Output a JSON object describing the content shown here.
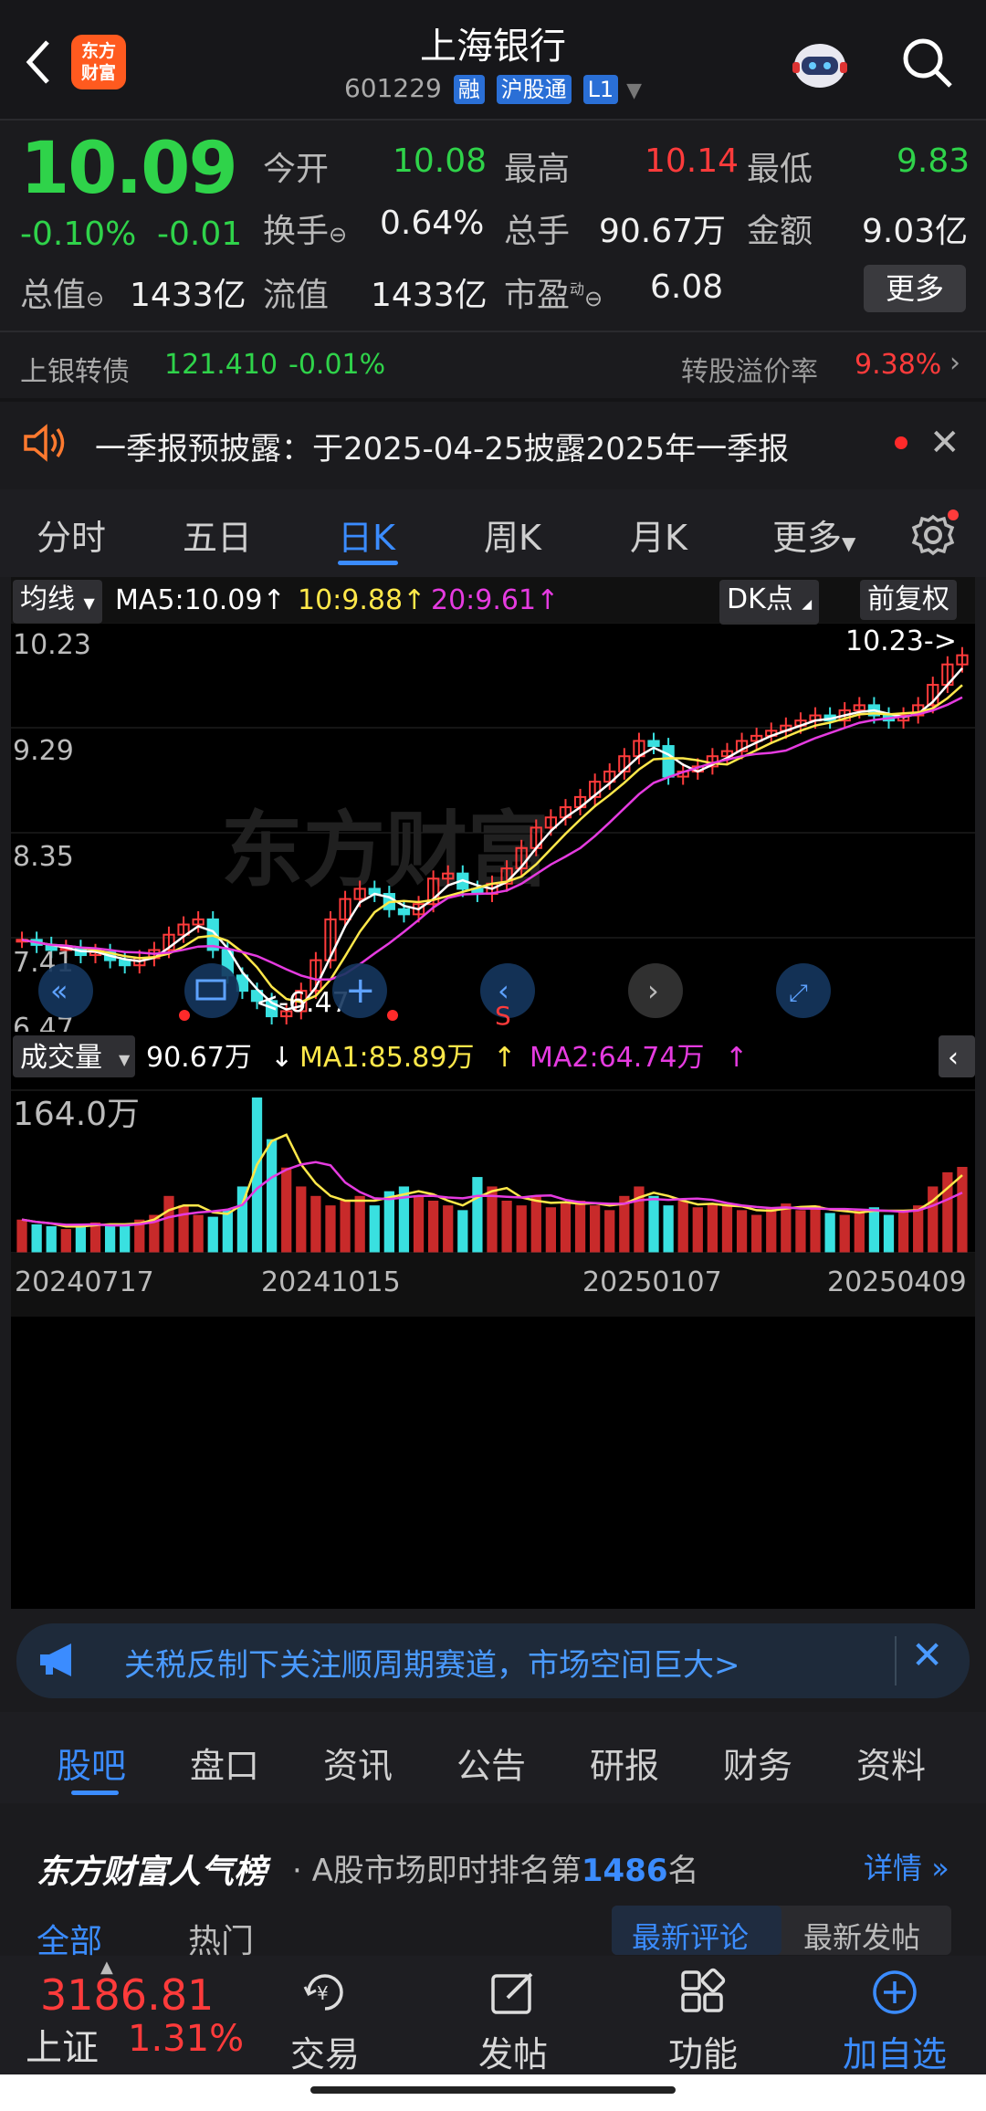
{
  "header": {
    "title": "上海银行",
    "code": "601229",
    "tags": [
      "融",
      "沪股通",
      "L1"
    ],
    "logo_text": "东方财富"
  },
  "quote": {
    "price": "10.09",
    "change_pct": "-0.10%",
    "change": "-0.01",
    "open_label": "今开",
    "open": "10.08",
    "high_label": "最高",
    "high": "10.14",
    "low_label": "最低",
    "low": "9.83",
    "turnover_label": "换手",
    "turnover": "0.64%",
    "volume_label": "总手",
    "volume": "90.67万",
    "amount_label": "金额",
    "amount": "9.03亿",
    "mktcap_label": "总值",
    "mktcap": "1433亿",
    "float_label": "流值",
    "float_cap": "1433亿",
    "pe_label": "市盈",
    "pe_sup": "动",
    "pe": "6.08",
    "more_label": "更多"
  },
  "bond": {
    "name": "上银转债",
    "price": "121.410",
    "change": "-0.01%",
    "premium_label": "转股溢价率",
    "premium": "9.38%"
  },
  "notice": {
    "text": "一季报预披露：于2025-04-25披露2025年一季报"
  },
  "chart_tabs": [
    "分时",
    "五日",
    "日K",
    "周K",
    "月K",
    "更多"
  ],
  "active_chart_tab": "日K",
  "ma_legend": {
    "selector": "均线",
    "ma5": "MA5:10.09",
    "ma10": "10:9.88",
    "ma20": "20:9.61",
    "dk": "DK点",
    "adjust": "前复权"
  },
  "price_axis": [
    "10.23",
    "9.29",
    "8.35",
    "7.41",
    "6.47"
  ],
  "price_markers": {
    "high": "10.23->",
    "low": "<-6.47"
  },
  "volume_legend": {
    "selector": "成交量",
    "value": "90.67万",
    "ma1": "MA1:85.89万",
    "ma2": "MA2:64.74万"
  },
  "volume_axis_max": "164.0万",
  "date_labels": [
    "20240717",
    "20241015",
    "20250107",
    "20250409"
  ],
  "watermark": "东方财富",
  "banner": {
    "text": "关税反制下关注顺周期赛道，市场空间巨大>"
  },
  "sub_tabs": [
    "股吧",
    "盘口",
    "资讯",
    "公告",
    "研报",
    "财务",
    "资料"
  ],
  "active_sub_tab": "股吧",
  "popularity": {
    "brand": "东方财富人气榜",
    "prefix": "· A股市场即时排名第",
    "rank": "1486",
    "suffix": "名",
    "details": "详情"
  },
  "comment_tabs": {
    "all": "全部",
    "hot": "热门",
    "latest_comment": "最新评论",
    "latest_post": "最新发帖"
  },
  "bottom": {
    "index_value": "3186.81",
    "index_name": "上证",
    "index_change": "1.31%",
    "trade": "交易",
    "post": "发帖",
    "function": "功能",
    "add_watch": "加自选"
  },
  "colors": {
    "up": "#ff3b3b",
    "down": "#2fd34a",
    "accent": "#3b8cff",
    "ma5": "#ffffff",
    "ma10": "#ffe84a",
    "ma20": "#e53be0"
  },
  "chart_data": {
    "type": "candlestick",
    "y_range": [
      6.47,
      10.23
    ],
    "price_points": [
      7.3,
      7.25,
      7.2,
      7.22,
      7.15,
      7.18,
      7.1,
      7.05,
      7.12,
      7.2,
      7.35,
      7.45,
      7.5,
      7.2,
      6.95,
      6.8,
      6.7,
      6.55,
      6.6,
      6.8,
      7.1,
      7.5,
      7.7,
      7.8,
      7.75,
      7.6,
      7.55,
      7.65,
      7.9,
      7.95,
      7.8,
      7.75,
      7.85,
      8.0,
      8.2,
      8.4,
      8.5,
      8.6,
      8.7,
      8.85,
      8.95,
      9.1,
      9.25,
      9.2,
      8.9,
      8.95,
      9.0,
      9.1,
      9.15,
      9.25,
      9.3,
      9.35,
      9.4,
      9.45,
      9.5,
      9.45,
      9.55,
      9.6,
      9.5,
      9.45,
      9.5,
      9.6,
      9.8,
      10.0,
      10.09
    ],
    "volume_points": [
      35,
      30,
      28,
      25,
      30,
      32,
      28,
      30,
      35,
      40,
      60,
      50,
      40,
      38,
      45,
      70,
      164,
      120,
      90,
      70,
      60,
      50,
      55,
      60,
      50,
      65,
      70,
      60,
      55,
      50,
      45,
      80,
      70,
      55,
      50,
      60,
      48,
      52,
      55,
      50,
      45,
      60,
      70,
      60,
      50,
      55,
      48,
      52,
      50,
      45,
      40,
      48,
      52,
      45,
      50,
      42,
      40,
      45,
      48,
      40,
      45,
      50,
      70,
      85,
      90.67
    ]
  }
}
